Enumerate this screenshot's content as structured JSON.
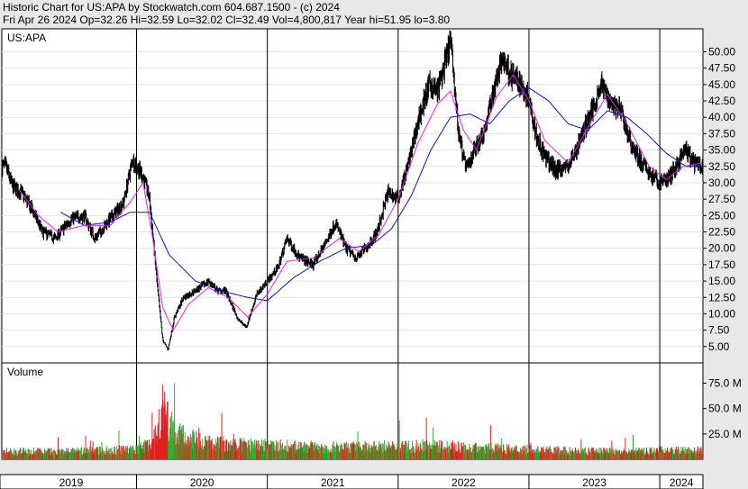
{
  "header": {
    "line1": "Historic Chart for US:APA by Stockwatch.com 604.687.1500 - (c) 2024",
    "line2": "Fri Apr 26 2024   Op=32.26   Hi=32.59   Lo=32.02   Cl=32.49   Vol=4,800,817   Year hi=51.95   lo=3.80"
  },
  "chart_data": [
    {
      "type": "line",
      "title": "US:APA",
      "ylim": [
        2.5,
        53.5
      ],
      "y_ticks": [
        "5.00",
        "7.50",
        "10.00",
        "12.50",
        "15.00",
        "17.50",
        "20.00",
        "22.50",
        "25.00",
        "27.50",
        "30.00",
        "32.50",
        "35.00",
        "37.50",
        "40.00",
        "42.50",
        "45.00",
        "47.50",
        "50.00"
      ],
      "x_ticks": [
        "2019",
        "2020",
        "2021",
        "2022",
        "2023",
        "2024"
      ],
      "colors": {
        "price": "#000000",
        "ma_fast": "#e020e0",
        "ma_slow": "#1010c0"
      },
      "price_keypoints": [
        [
          2019.0,
          32.5
        ],
        [
          2019.05,
          29.5
        ],
        [
          2019.12,
          28.5
        ],
        [
          2019.2,
          26.0
        ],
        [
          2019.28,
          22.5
        ],
        [
          2019.38,
          21.5
        ],
        [
          2019.5,
          24.5
        ],
        [
          2019.6,
          25.0
        ],
        [
          2019.68,
          21.5
        ],
        [
          2019.8,
          24.5
        ],
        [
          2019.9,
          27.0
        ],
        [
          2019.97,
          33.5
        ],
        [
          2020.05,
          31.0
        ],
        [
          2020.1,
          27.5
        ],
        [
          2020.16,
          14.0
        ],
        [
          2020.2,
          6.0
        ],
        [
          2020.24,
          4.5
        ],
        [
          2020.29,
          9.5
        ],
        [
          2020.36,
          12.5
        ],
        [
          2020.45,
          13.5
        ],
        [
          2020.55,
          15.0
        ],
        [
          2020.62,
          13.5
        ],
        [
          2020.68,
          13.5
        ],
        [
          2020.78,
          9.0
        ],
        [
          2020.84,
          8.0
        ],
        [
          2020.92,
          13.0
        ],
        [
          2021.0,
          15.0
        ],
        [
          2021.08,
          17.0
        ],
        [
          2021.15,
          21.5
        ],
        [
          2021.25,
          18.5
        ],
        [
          2021.35,
          17.5
        ],
        [
          2021.45,
          21.0
        ],
        [
          2021.52,
          24.0
        ],
        [
          2021.6,
          20.0
        ],
        [
          2021.68,
          18.5
        ],
        [
          2021.75,
          20.0
        ],
        [
          2021.84,
          22.5
        ],
        [
          2021.92,
          28.5
        ],
        [
          2022.0,
          27.5
        ],
        [
          2022.08,
          33.0
        ],
        [
          2022.16,
          40.0
        ],
        [
          2022.24,
          45.0
        ],
        [
          2022.3,
          44.0
        ],
        [
          2022.37,
          49.0
        ],
        [
          2022.4,
          51.9
        ],
        [
          2022.46,
          38.0
        ],
        [
          2022.52,
          32.0
        ],
        [
          2022.58,
          35.0
        ],
        [
          2022.66,
          38.0
        ],
        [
          2022.74,
          45.0
        ],
        [
          2022.8,
          49.0
        ],
        [
          2022.86,
          46.5
        ],
        [
          2022.92,
          45.5
        ],
        [
          2023.0,
          43.0
        ],
        [
          2023.06,
          37.0
        ],
        [
          2023.12,
          34.0
        ],
        [
          2023.2,
          32.0
        ],
        [
          2023.3,
          32.5
        ],
        [
          2023.38,
          36.0
        ],
        [
          2023.48,
          41.0
        ],
        [
          2023.55,
          45.0
        ],
        [
          2023.62,
          42.5
        ],
        [
          2023.7,
          41.0
        ],
        [
          2023.78,
          36.0
        ],
        [
          2023.86,
          33.0
        ],
        [
          2023.94,
          31.0
        ],
        [
          2024.0,
          30.0
        ],
        [
          2024.08,
          31.0
        ],
        [
          2024.14,
          33.0
        ],
        [
          2024.2,
          35.0
        ],
        [
          2024.26,
          33.0
        ],
        [
          2024.32,
          32.5
        ]
      ],
      "ma_fast_keypoints": [
        [
          2019.1,
          29.0
        ],
        [
          2019.25,
          25.0
        ],
        [
          2019.4,
          22.5
        ],
        [
          2019.6,
          23.5
        ],
        [
          2019.8,
          23.5
        ],
        [
          2019.95,
          27.0
        ],
        [
          2020.05,
          30.0
        ],
        [
          2020.12,
          22.0
        ],
        [
          2020.2,
          11.0
        ],
        [
          2020.28,
          7.5
        ],
        [
          2020.4,
          11.5
        ],
        [
          2020.55,
          14.0
        ],
        [
          2020.7,
          12.5
        ],
        [
          2020.85,
          9.5
        ],
        [
          2021.0,
          13.0
        ],
        [
          2021.15,
          18.0
        ],
        [
          2021.35,
          18.5
        ],
        [
          2021.55,
          21.5
        ],
        [
          2021.7,
          19.5
        ],
        [
          2021.85,
          22.0
        ],
        [
          2022.0,
          27.5
        ],
        [
          2022.15,
          36.0
        ],
        [
          2022.3,
          42.0
        ],
        [
          2022.4,
          44.0
        ],
        [
          2022.5,
          38.0
        ],
        [
          2022.6,
          35.0
        ],
        [
          2022.75,
          43.0
        ],
        [
          2022.88,
          46.5
        ],
        [
          2023.0,
          42.5
        ],
        [
          2023.12,
          36.5
        ],
        [
          2023.3,
          33.0
        ],
        [
          2023.48,
          39.5
        ],
        [
          2023.6,
          43.5
        ],
        [
          2023.75,
          39.0
        ],
        [
          2023.92,
          32.5
        ],
        [
          2024.05,
          30.5
        ],
        [
          2024.18,
          32.5
        ],
        [
          2024.32,
          33.0
        ]
      ],
      "ma_slow_keypoints": [
        [
          2019.42,
          25.5
        ],
        [
          2019.6,
          23.5
        ],
        [
          2019.8,
          24.0
        ],
        [
          2019.95,
          25.5
        ],
        [
          2020.1,
          25.5
        ],
        [
          2020.25,
          19.0
        ],
        [
          2020.45,
          15.0
        ],
        [
          2020.65,
          13.5
        ],
        [
          2020.85,
          12.5
        ],
        [
          2021.0,
          12.0
        ],
        [
          2021.2,
          15.5
        ],
        [
          2021.4,
          18.0
        ],
        [
          2021.6,
          20.0
        ],
        [
          2021.8,
          20.5
        ],
        [
          2021.95,
          23.0
        ],
        [
          2022.1,
          28.0
        ],
        [
          2022.25,
          35.0
        ],
        [
          2022.4,
          40.0
        ],
        [
          2022.55,
          40.5
        ],
        [
          2022.7,
          39.0
        ],
        [
          2022.85,
          42.5
        ],
        [
          2023.0,
          44.5
        ],
        [
          2023.15,
          42.5
        ],
        [
          2023.3,
          39.0
        ],
        [
          2023.45,
          38.0
        ],
        [
          2023.6,
          41.0
        ],
        [
          2023.75,
          40.0
        ],
        [
          2023.9,
          37.5
        ],
        [
          2024.05,
          34.5
        ],
        [
          2024.2,
          32.5
        ],
        [
          2024.32,
          32.5
        ]
      ]
    },
    {
      "type": "bar",
      "title": "Volume",
      "ylim": [
        0,
        95
      ],
      "y_ticks": [
        "25.0 M",
        "50.0 M",
        "75.0 M"
      ],
      "unit": "M",
      "colors": {
        "up": "#30b030",
        "down": "#e02020"
      },
      "volume_keypoints": [
        [
          2019.0,
          8
        ],
        [
          2019.5,
          8
        ],
        [
          2019.9,
          10
        ],
        [
          2020.0,
          10
        ],
        [
          2020.1,
          16
        ],
        [
          2020.16,
          30
        ],
        [
          2020.2,
          55
        ],
        [
          2020.24,
          40
        ],
        [
          2020.28,
          30
        ],
        [
          2020.35,
          24
        ],
        [
          2020.45,
          20
        ],
        [
          2020.6,
          16
        ],
        [
          2020.8,
          15
        ],
        [
          2021.0,
          14
        ],
        [
          2021.5,
          12
        ],
        [
          2022.0,
          13
        ],
        [
          2022.2,
          14
        ],
        [
          2022.5,
          12
        ],
        [
          2023.0,
          10
        ],
        [
          2023.5,
          8
        ],
        [
          2024.0,
          9
        ],
        [
          2024.32,
          9
        ]
      ]
    }
  ]
}
